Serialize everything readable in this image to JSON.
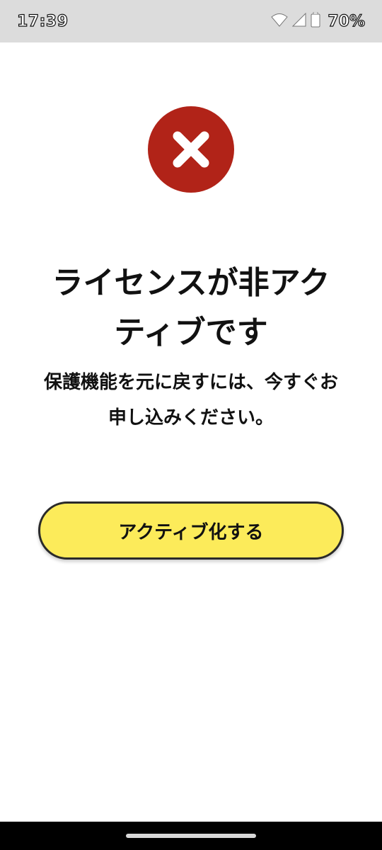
{
  "status_bar": {
    "time": "17:39",
    "battery": "70%",
    "icons": [
      "wifi-icon",
      "cellular-signal-icon",
      "battery-icon"
    ]
  },
  "error": {
    "icon": "error-x-icon",
    "color": "#b12318",
    "title_line1": "ライセンスが非アク",
    "title_line2": "ティブです",
    "message_line1": "保護機能を元に戻すには、今すぐお",
    "message_line2": "申し込みください。"
  },
  "button": {
    "label": "アクティブ化する",
    "color": "#fceb5a"
  }
}
